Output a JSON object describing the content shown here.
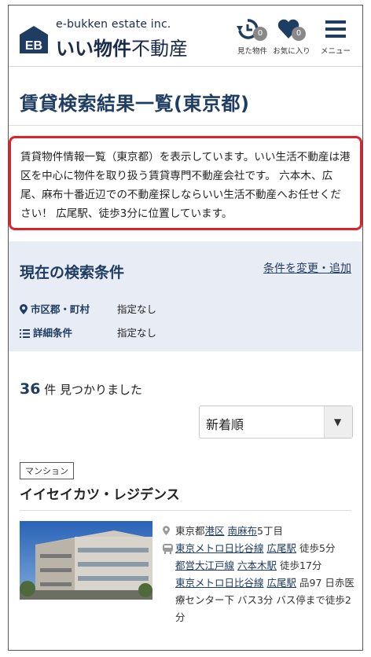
{
  "header": {
    "brand_en": "e-bukken estate inc.",
    "brand_ja_bold": "いい物件",
    "brand_ja_rest": "不動産",
    "logo_text": "EB",
    "nav": [
      {
        "label": "見た物件",
        "count": "0",
        "icon": "history-icon"
      },
      {
        "label": "お気に入り",
        "count": "0",
        "icon": "heart-icon"
      },
      {
        "label": "メニュー",
        "icon": "menu-icon"
      }
    ]
  },
  "page": {
    "title": "賃貸検索結果一覧(東京都)",
    "intro": "賃貸物件情報一覧（東京都）を表示しています。いい生活不動産は港区を中心に物件を取り扱う賃貸専門不動産会社です。 六本木、広尾、麻布十番近辺での不動産探しならいい生活不動産へお任せください！ 広尾駅、徒歩3分に位置しています。"
  },
  "conditions": {
    "title": "現在の検索条件",
    "change_link": "条件を変更・追加",
    "rows": [
      {
        "label": "市区郡・町村",
        "value": "指定なし",
        "icon": "pin-icon"
      },
      {
        "label": "詳細条件",
        "value": "指定なし",
        "icon": "list-icon"
      }
    ]
  },
  "results": {
    "count": "36",
    "count_suffix": "件 見つかりました",
    "sort_selected": "新着順",
    "sort_arrow": "▼"
  },
  "listing": {
    "type_tag": "マンション",
    "name": "イイセイカツ・レジデンス",
    "address_prefix": "東京都",
    "address_ward": "港区",
    "address_town": "南麻布",
    "address_rest": "5丁目",
    "access": [
      {
        "line": "東京メトロ日比谷線",
        "station": "広尾駅",
        "detail": "徒歩5分"
      },
      {
        "line": "都営大江戸線",
        "station": "六本木駅",
        "detail": "徒歩17分"
      },
      {
        "line": "東京メトロ日比谷線",
        "station": "広尾駅",
        "detail": "品97 日赤医療センター下 バス3分 バス停まで徒歩2分"
      }
    ]
  }
}
